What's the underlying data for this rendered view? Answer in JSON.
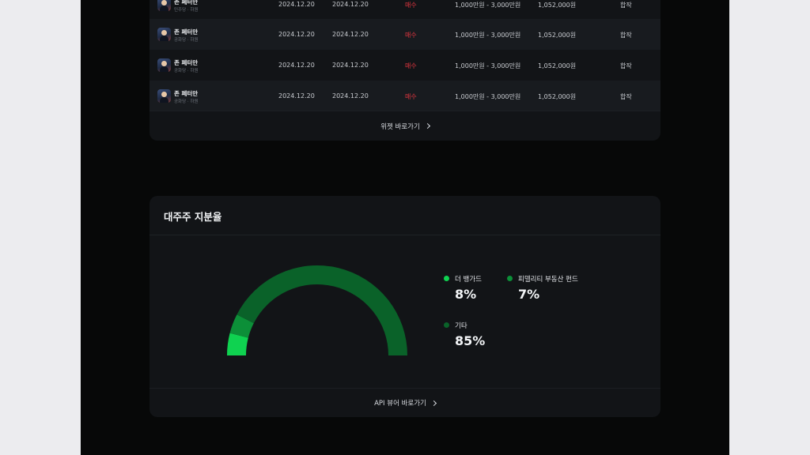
{
  "trades": {
    "rows": [
      {
        "name": "존 페터만",
        "sub": "민주당 · 하원",
        "date1": "2024.12.20",
        "date2": "2024.12.20",
        "type": "매수",
        "range": "1,000만원 - 3,000만원",
        "price": "1,052,000원",
        "status": "합작"
      },
      {
        "name": "존 페터만",
        "sub": "공화당 · 하원",
        "date1": "2024.12.20",
        "date2": "2024.12.20",
        "type": "매수",
        "range": "1,000만원 - 3,000만원",
        "price": "1,052,000원",
        "status": "합작"
      },
      {
        "name": "존 페터만",
        "sub": "공화당 · 하원",
        "date1": "2024.12.20",
        "date2": "2024.12.20",
        "type": "매수",
        "range": "1,000만원 - 3,000만원",
        "price": "1,052,000원",
        "status": "합작"
      },
      {
        "name": "존 페터만",
        "sub": "공화당 · 하원",
        "date1": "2024.12.20",
        "date2": "2024.12.20",
        "type": "매수",
        "range": "1,000만원 - 3,000만원",
        "price": "1,052,000원",
        "status": "합작"
      }
    ],
    "link_label": "위젯 바로가기"
  },
  "holders": {
    "title": "대주주 지분율",
    "items": [
      {
        "label": "더 뱅가드",
        "percent": "8%",
        "value": 8,
        "color": "#0fd250"
      },
      {
        "label": "피델리티 부동산 펀드",
        "percent": "7%",
        "value": 7,
        "color": "#0c8f38"
      },
      {
        "label": "기타",
        "percent": "85%",
        "value": 85,
        "color": "#0a6229"
      }
    ],
    "link_label": "API 뷰어 바로가기"
  }
}
